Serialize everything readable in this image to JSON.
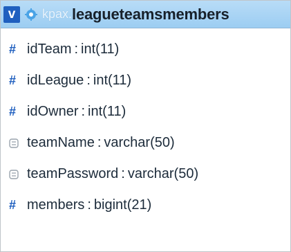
{
  "header": {
    "badge_label": "v",
    "icon": "gear-icon",
    "database": "kpax",
    "separator": ".",
    "table": "leagueteamsmembers"
  },
  "columns": [
    {
      "name": "idTeam",
      "type": "int(11)",
      "icon": "hash-icon"
    },
    {
      "name": "idLeague",
      "type": "int(11)",
      "icon": "hash-icon"
    },
    {
      "name": "idOwner",
      "type": "int(11)",
      "icon": "hash-icon"
    },
    {
      "name": "teamName",
      "type": "varchar(50)",
      "icon": "text-field-icon"
    },
    {
      "name": "teamPassword",
      "type": "varchar(50)",
      "icon": "text-field-icon"
    },
    {
      "name": "members",
      "type": "bigint(21)",
      "icon": "hash-icon"
    }
  ],
  "colon": ":",
  "colors": {
    "header_bg": "#9ccdf2",
    "badge_bg": "#1f5fbf",
    "hash_color": "#1f5fbf"
  }
}
